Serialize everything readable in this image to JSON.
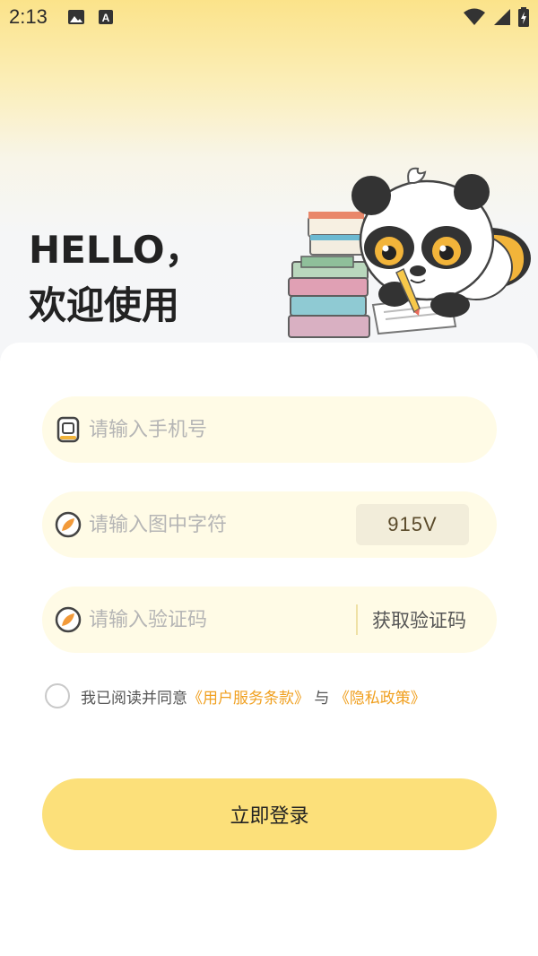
{
  "status_bar": {
    "time": "2:13",
    "left_icons": [
      "image-icon",
      "font-a-icon"
    ],
    "right_icons": [
      "wifi-icon",
      "signal-icon",
      "battery-icon"
    ]
  },
  "header": {
    "line1": "HELLO，",
    "line2": "欢迎使用"
  },
  "form": {
    "phone": {
      "placeholder": "请输入手机号",
      "icon": "phone-icon"
    },
    "captcha": {
      "placeholder": "请输入图中字符",
      "icon": "shield-icon",
      "code": "915V"
    },
    "sms": {
      "placeholder": "请输入验证码",
      "icon": "shield-icon",
      "get_code_label": "获取验证码"
    }
  },
  "agreement": {
    "prefix": "我已阅读并同意",
    "terms_link": "《用户服务条款》",
    "joiner": "与",
    "privacy_link": "《隐私政策》"
  },
  "login_button": {
    "label": "立即登录"
  },
  "colors": {
    "accent": "#fce07a",
    "field_bg": "#fffbe6",
    "link": "#f0a020"
  }
}
